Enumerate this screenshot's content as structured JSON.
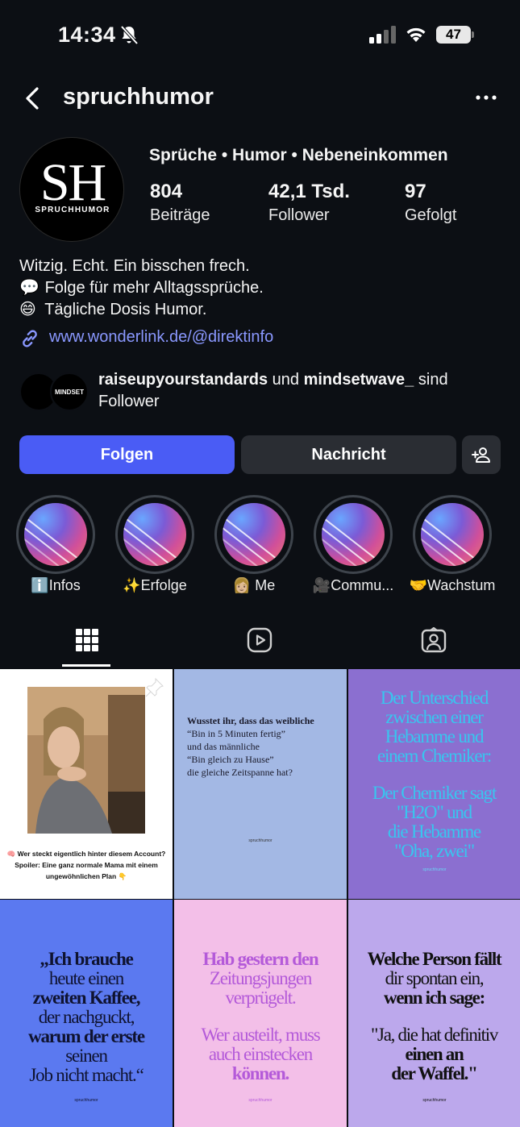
{
  "status": {
    "time": "14:34",
    "battery": "47"
  },
  "header": {
    "username": "spruchhumor"
  },
  "avatar": {
    "initials": "SH",
    "subtitle": "SPRUCHHUMOR"
  },
  "profile": {
    "category": "Sprüche • Humor • Nebeneinkommen",
    "stats": [
      {
        "value": "804",
        "label": "Beiträge"
      },
      {
        "value": "42,1 Tsd.",
        "label": "Follower"
      },
      {
        "value": "97",
        "label": "Gefolgt"
      }
    ],
    "bio": [
      {
        "emoji": "",
        "text": "Witzig. Echt. Ein bisschen frech."
      },
      {
        "emoji": "💬",
        "text": "Folge für mehr Alltagssprüche."
      },
      {
        "emoji": "😄",
        "text": "Tägliche Dosis Humor."
      }
    ],
    "link": "www.wonderlink.de/@direktinfo"
  },
  "followed_by": {
    "mini_avatar_text": "MINDSET",
    "user1": "raiseupyourstandards",
    "connector": "und",
    "user2": "mindsetwave_",
    "suffix_line1": "sind",
    "suffix_line2": "Follower"
  },
  "actions": {
    "follow": "Folgen",
    "message": "Nachricht"
  },
  "highlights": [
    {
      "label": "ℹ️Infos"
    },
    {
      "label": "✨Erfolge"
    },
    {
      "label": "👩🏼 Me"
    },
    {
      "label": "🎥Commu..."
    },
    {
      "label": "🤝Wachstum"
    }
  ],
  "posts": {
    "p1_caption_line1": "🧠 Wer steckt eigentlich hinter diesem Account?",
    "p1_caption_line2": "Spoiler: Eine ganz normale Mama mit einem",
    "p1_caption_line3": "ungewöhnlichen Plan 👇",
    "p2_lines": [
      "Wusstet ihr, dass das weibliche",
      "“Bin in 5 Minuten fertig”",
      "und das männliche",
      "“Bin gleich zu Hause”",
      "die gleiche Zeitspanne hat?"
    ],
    "p2_brand": "spruchhumor",
    "p3_lines": [
      "Der Unterschied",
      "zwischen einer",
      "Hebamme und",
      "einem Chemiker:",
      "Der Chemiker sagt",
      "\"H2O\" und",
      "die Hebamme",
      "\"Oha, zwei\""
    ],
    "p3_brand": "spruchhumor",
    "p4_lines": [
      "„Ich brauche",
      "heute einen",
      "zweiten Kaffee,",
      "der nachguckt,",
      "warum der erste",
      "seinen",
      "Job nicht macht.“"
    ],
    "p4_brand": "spruchhumor",
    "p5_lines": [
      "Hab gestern den",
      "Zeitungsjungen",
      "verprügelt.",
      "Wer austeilt, muss",
      "auch einstecken",
      "können."
    ],
    "p5_brand": "spruchhumor",
    "p6_lines": [
      "Welche Person fällt",
      "dir spontan ein,",
      "wenn ich sage:",
      "\"Ja, die hat definitiv",
      "einen an",
      "der Waffel.\""
    ],
    "p6_brand": "spruchhumor"
  },
  "colors": {
    "background": "#0c0f14",
    "follow_button": "#4a5cf5",
    "secondary_button": "#2a2d33",
    "link": "#8a98ff",
    "tile2_bg": "#a3b8e4",
    "tile3_bg": "#8b6fd0",
    "tile3_text": "#38c6ef",
    "tile4_bg": "#5b79f0",
    "tile5_bg": "#f3bfe8",
    "tile5_text": "#b45ad9",
    "tile6_bg": "#bca8ec"
  }
}
